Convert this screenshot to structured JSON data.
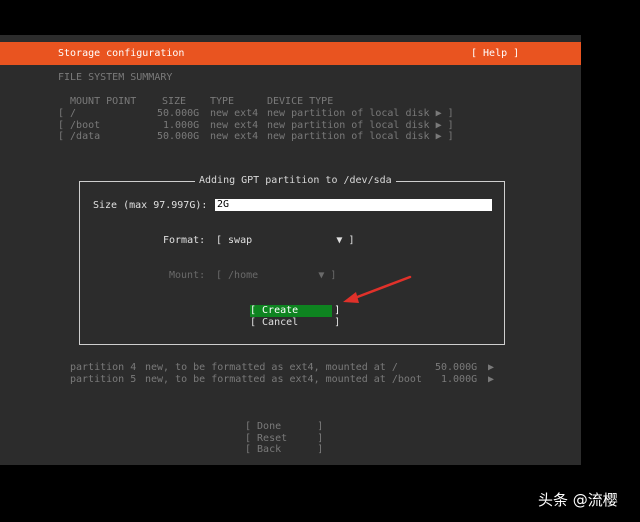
{
  "header": {
    "title": "Storage configuration",
    "help": "[ Help ]"
  },
  "summary": {
    "heading": "FILE SYSTEM SUMMARY",
    "columns": [
      "MOUNT POINT",
      "SIZE",
      "TYPE",
      "DEVICE TYPE"
    ],
    "rows": [
      {
        "mount": "[ /",
        "size": "50.000G",
        "type": "new ext4",
        "device": "new partition of local disk ▶ ]"
      },
      {
        "mount": "[ /boot",
        "size": "1.000G",
        "type": "new ext4",
        "device": "new partition of local disk ▶ ]"
      },
      {
        "mount": "[ /data",
        "size": "50.000G",
        "type": "new ext4",
        "device": "new partition of local disk ▶ ]"
      }
    ]
  },
  "dialog": {
    "title": "Adding GPT partition to /dev/sda",
    "size_label": "Size (max 97.997G):",
    "size_value": "2G",
    "format_label": "Format:",
    "format_value": "[ swap              ▼ ]",
    "mount_label": "Mount:",
    "mount_value": "[ /home          ▼ ]",
    "create": "[ Create      ]",
    "cancel": "[ Cancel      ]"
  },
  "partitions": [
    {
      "label": "partition 4",
      "desc": "new, to be formatted as ext4, mounted at /",
      "size": "50.000G",
      "arrow": "▶"
    },
    {
      "label": "partition 5",
      "desc": "new, to be formatted as ext4, mounted at /boot",
      "size": "1.000G",
      "arrow": "▶"
    }
  ],
  "footer": {
    "done": "[ Done      ]",
    "reset": "[ Reset     ]",
    "back": "[ Back      ]"
  },
  "watermark": "头条 @流樱",
  "colors": {
    "accent": "#e95420",
    "button_active": "#0e8420",
    "annotation_arrow": "#e0312a"
  }
}
